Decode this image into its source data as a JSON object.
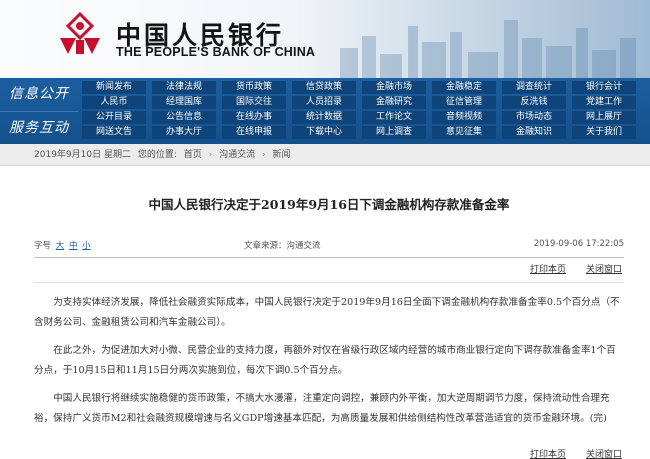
{
  "header": {
    "cn_name": "中国人民银行",
    "en_name": "THE PEOPLE'S BANK OF CHINA",
    "brand_color": "#c8102e"
  },
  "nav": {
    "section1_label": "信息公开",
    "section2_label": "服务互动",
    "row1": [
      "新闻发布",
      "法律法规",
      "货币政策",
      "信贷政策",
      "金融市场",
      "金融稳定",
      "调查统计",
      "银行会计",
      "支付体系",
      "金融科技"
    ],
    "row2": [
      "人民币",
      "经理国库",
      "国际交往",
      "人员招录",
      "金融研究",
      "征信管理",
      "反洗钱",
      "党建工作",
      "工会工作",
      "金融标准化"
    ],
    "row3": [
      "公开目录",
      "公告信息",
      "在线办事",
      "统计数据",
      "工作论文",
      "音频视频",
      "市场动态",
      "网上展厅",
      "报告下载",
      "报刊年鉴"
    ],
    "row4": [
      "网送文告",
      "办事大厅",
      "在线申报",
      "下载中心",
      "网上调查",
      "意见征集",
      "金融知识",
      "关于我们"
    ]
  },
  "breadcrumb": {
    "date": "2019年9月10日 星期二",
    "location_label": "您的位置:",
    "items": [
      "首页",
      "沟通交流",
      "新闻"
    ],
    "separator": "›"
  },
  "article": {
    "title": "中国人民银行决定于2019年9月16日下调金融机构存款准备金率",
    "font_size_label": "字号",
    "font_sizes": [
      "大",
      "中",
      "小"
    ],
    "source": "文章来源：沟通交流",
    "date": "2019-09-06 17:22:05",
    "print_label": "打印本页",
    "close_label": "关闭窗口",
    "paragraphs": [
      "为支持实体经济发展，降低社会融资实际成本，中国人民银行决定于2019年9月16日全面下调金融机构存款准备金率0.5个百分点（不含财务公司、金融租赁公司和汽车金融公司）。",
      "在此之外，为促进加大对小微、民营企业的支持力度，再额外对仅在省级行政区域内经营的城市商业银行定向下调存款准备金率1个百分点，于10月15日和11月15日分两次实施到位，每次下调0.5个百分点。",
      "中国人民银行将继续实施稳健的货币政策，不搞大水漫灌，注重定向调控，兼顾内外平衡，加大逆周期调节力度，保持流动性合理充裕，保持广义货币M2和社会融资规模增速与名义GDP增速基本匹配，为高质量发展和供给侧结构性改革营造适宜的货币金融环境。(完)"
    ]
  }
}
